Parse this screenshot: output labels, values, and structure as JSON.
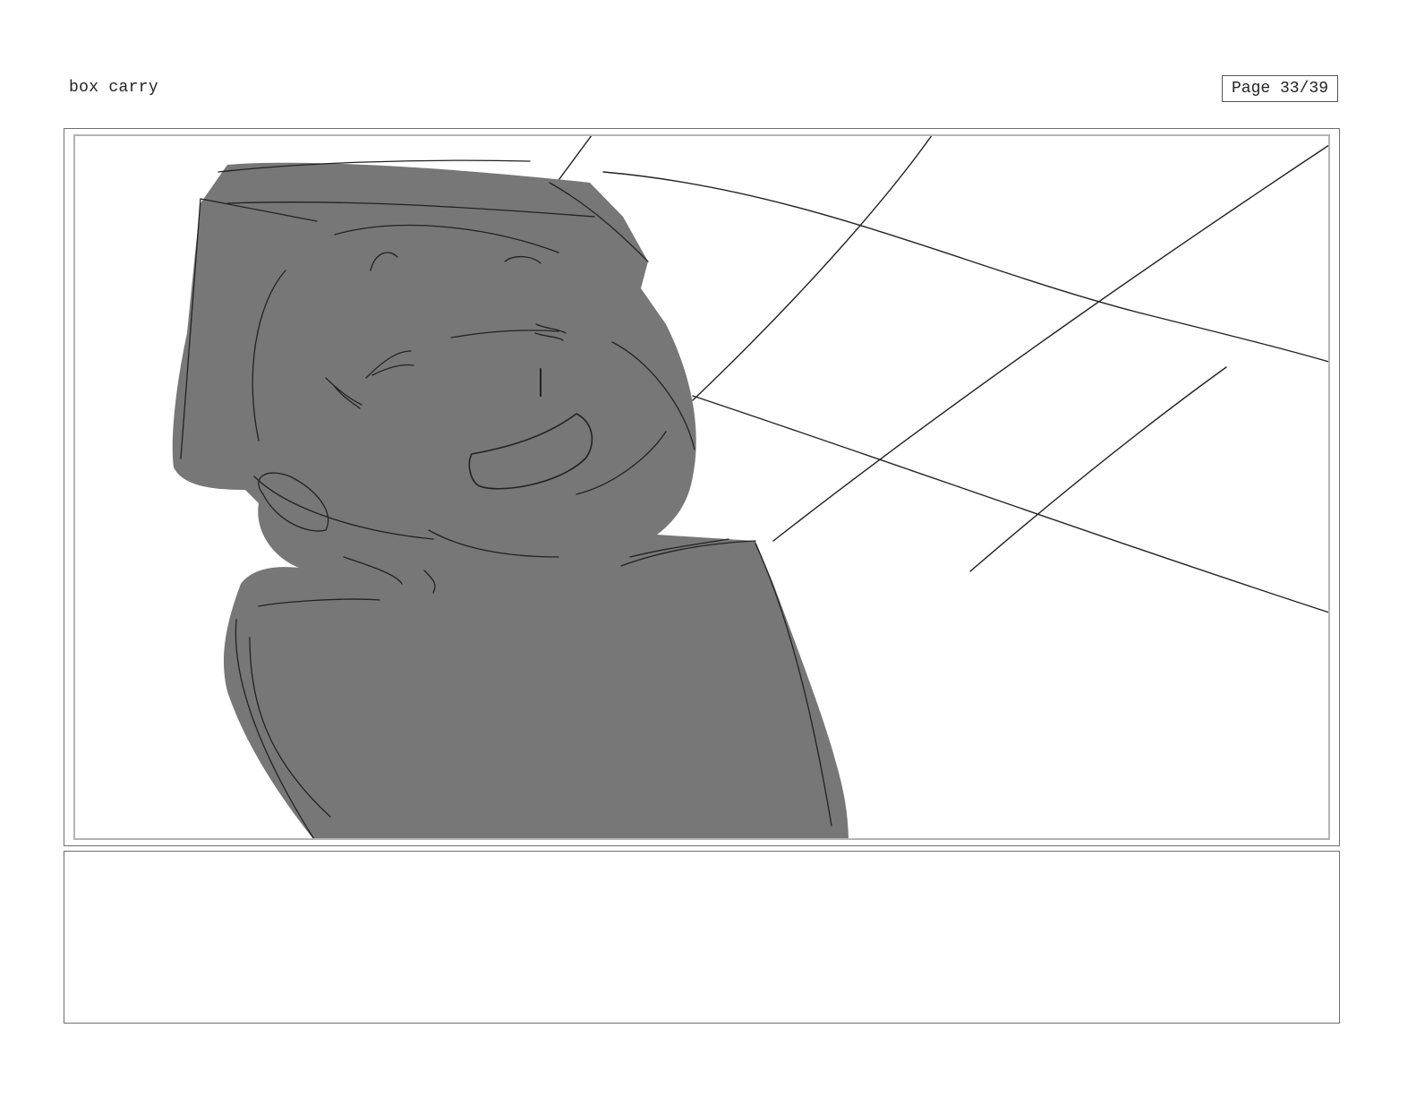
{
  "header": {
    "title": "box carry",
    "page_label": "Page 33/39"
  },
  "panel": {
    "sketch_description_hidden": false,
    "fill_color": "#777777",
    "line_color": "#222222"
  },
  "notes": {
    "text": ""
  }
}
